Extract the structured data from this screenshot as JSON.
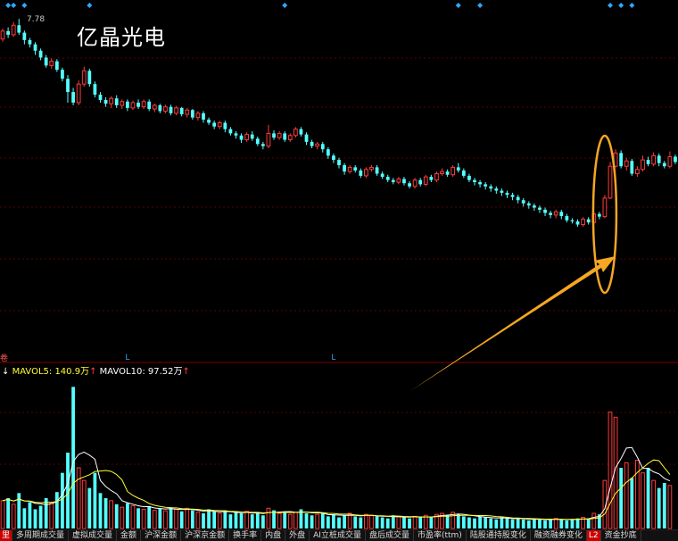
{
  "stock": {
    "name": "亿晶光电",
    "max_price_label": "7.78"
  },
  "volume_legend": {
    "arrow_prefix": "↓",
    "mavol5_label": "MAVOL5:",
    "mavol5_value": "140.9万",
    "mavol5_arrow": "↑",
    "mavol10_label": "MAVOL10:",
    "mavol10_value": "97.52万",
    "mavol10_arrow": "↑"
  },
  "corner_tag": "卷",
  "markers": {
    "l_label": "L"
  },
  "tabs": [
    {
      "label": "里",
      "style": "red"
    },
    {
      "label": "多周期成交量",
      "style": ""
    },
    {
      "label": "虚拟成交量",
      "style": ""
    },
    {
      "label": "金额",
      "style": ""
    },
    {
      "label": "沪深金额",
      "style": ""
    },
    {
      "label": "沪深京金额",
      "style": ""
    },
    {
      "label": "换手率",
      "style": ""
    },
    {
      "label": "内盘",
      "style": ""
    },
    {
      "label": "外盘",
      "style": ""
    },
    {
      "label": "AI立桩成交量",
      "style": ""
    },
    {
      "label": "盘后成交量",
      "style": ""
    },
    {
      "label": "市盈率(ttm)",
      "style": ""
    },
    {
      "label": "陆股通持股变化",
      "style": ""
    },
    {
      "label": "融资融券变化",
      "style": ""
    },
    {
      "label": "L2",
      "style": "red"
    },
    {
      "label": "资金抄底",
      "style": ""
    }
  ],
  "colors": {
    "up": "#ff3b3b",
    "down": "#54ffff",
    "ma5": "#ffffff",
    "ma10": "#ffff33",
    "highlight": "#f5a623",
    "grid": "#5a0000",
    "marker": "#2ea8ff"
  },
  "chart_data": {
    "type": "candlestick",
    "price_range": [
      3.0,
      7.9
    ],
    "candles": [
      [
        7.4,
        7.55,
        7.35,
        7.6
      ],
      [
        7.55,
        7.48,
        7.42,
        7.62
      ],
      [
        7.48,
        7.66,
        7.44,
        7.72
      ],
      [
        7.66,
        7.52,
        7.48,
        7.78
      ],
      [
        7.52,
        7.38,
        7.3,
        7.56
      ],
      [
        7.38,
        7.3,
        7.24,
        7.42
      ],
      [
        7.3,
        7.18,
        7.1,
        7.34
      ],
      [
        7.18,
        7.05,
        7.0,
        7.22
      ],
      [
        7.05,
        6.9,
        6.86,
        7.1
      ],
      [
        6.9,
        6.98,
        6.84,
        7.04
      ],
      [
        6.98,
        6.82,
        6.78,
        7.02
      ],
      [
        6.82,
        6.65,
        6.6,
        6.86
      ],
      [
        6.65,
        6.4,
        6.2,
        6.72
      ],
      [
        6.4,
        6.2,
        6.15,
        6.48
      ],
      [
        6.2,
        6.55,
        6.15,
        6.62
      ],
      [
        6.55,
        6.8,
        6.5,
        6.88
      ],
      [
        6.8,
        6.55,
        6.5,
        6.84
      ],
      [
        6.55,
        6.35,
        6.3,
        6.6
      ],
      [
        6.35,
        6.25,
        6.2,
        6.4
      ],
      [
        6.25,
        6.18,
        6.12,
        6.3
      ],
      [
        6.18,
        6.28,
        6.1,
        6.32
      ],
      [
        6.28,
        6.15,
        6.1,
        6.34
      ],
      [
        6.15,
        6.22,
        6.08,
        6.26
      ],
      [
        6.22,
        6.1,
        6.04,
        6.26
      ],
      [
        6.1,
        6.2,
        6.06,
        6.24
      ],
      [
        6.2,
        6.12,
        6.08,
        6.26
      ],
      [
        6.12,
        6.22,
        6.08,
        6.26
      ],
      [
        6.22,
        6.08,
        6.04,
        6.26
      ],
      [
        6.08,
        6.15,
        6.02,
        6.18
      ],
      [
        6.15,
        6.04,
        6.0,
        6.18
      ],
      [
        6.04,
        6.12,
        6.0,
        6.16
      ],
      [
        6.12,
        6.0,
        5.96,
        6.16
      ],
      [
        6.0,
        6.1,
        5.96,
        6.14
      ],
      [
        6.1,
        5.98,
        5.94,
        6.12
      ],
      [
        5.98,
        6.06,
        5.92,
        6.1
      ],
      [
        6.06,
        5.92,
        5.88,
        6.08
      ],
      [
        5.92,
        6.0,
        5.86,
        6.04
      ],
      [
        6.0,
        5.88,
        5.82,
        6.04
      ],
      [
        5.88,
        5.82,
        5.78,
        5.92
      ],
      [
        5.82,
        5.75,
        5.7,
        5.86
      ],
      [
        5.75,
        5.82,
        5.7,
        5.86
      ],
      [
        5.82,
        5.7,
        5.64,
        5.86
      ],
      [
        5.7,
        5.62,
        5.58,
        5.74
      ],
      [
        5.62,
        5.58,
        5.52,
        5.66
      ],
      [
        5.58,
        5.5,
        5.44,
        5.62
      ],
      [
        5.5,
        5.6,
        5.46,
        5.64
      ],
      [
        5.6,
        5.52,
        5.48,
        5.66
      ],
      [
        5.52,
        5.42,
        5.38,
        5.56
      ],
      [
        5.42,
        5.38,
        5.32,
        5.46
      ],
      [
        5.38,
        5.62,
        5.34,
        5.78
      ],
      [
        5.62,
        5.54,
        5.5,
        5.68
      ],
      [
        5.54,
        5.62,
        5.5,
        5.66
      ],
      [
        5.62,
        5.5,
        5.46,
        5.66
      ],
      [
        5.5,
        5.58,
        5.46,
        5.62
      ],
      [
        5.58,
        5.7,
        5.54,
        5.74
      ],
      [
        5.7,
        5.6,
        5.56,
        5.74
      ],
      [
        5.6,
        5.46,
        5.4,
        5.64
      ],
      [
        5.46,
        5.38,
        5.34,
        5.5
      ],
      [
        5.38,
        5.42,
        5.32,
        5.46
      ],
      [
        5.42,
        5.32,
        5.26,
        5.46
      ],
      [
        5.32,
        5.2,
        5.14,
        5.36
      ],
      [
        5.2,
        5.12,
        5.06,
        5.24
      ],
      [
        5.12,
        5.02,
        4.96,
        5.16
      ],
      [
        5.02,
        4.9,
        4.84,
        5.06
      ],
      [
        4.9,
        4.98,
        4.86,
        5.02
      ],
      [
        4.98,
        4.92,
        4.88,
        5.02
      ],
      [
        4.92,
        4.82,
        4.78,
        4.96
      ],
      [
        4.82,
        4.94,
        4.78,
        4.98
      ],
      [
        4.94,
        4.98,
        4.9,
        5.02
      ],
      [
        4.98,
        4.86,
        4.82,
        5.02
      ],
      [
        4.86,
        4.8,
        4.76,
        4.9
      ],
      [
        4.8,
        4.74,
        4.7,
        4.84
      ],
      [
        4.74,
        4.7,
        4.66,
        4.78
      ],
      [
        4.7,
        4.76,
        4.66,
        4.8
      ],
      [
        4.76,
        4.68,
        4.64,
        4.8
      ],
      [
        4.68,
        4.62,
        4.58,
        4.72
      ],
      [
        4.62,
        4.74,
        4.58,
        4.78
      ],
      [
        4.74,
        4.66,
        4.62,
        4.78
      ],
      [
        4.66,
        4.8,
        4.62,
        4.84
      ],
      [
        4.8,
        4.74,
        4.7,
        4.84
      ],
      [
        4.74,
        4.86,
        4.7,
        4.9
      ],
      [
        4.86,
        4.9,
        4.82,
        4.96
      ],
      [
        4.9,
        4.84,
        4.8,
        4.94
      ],
      [
        4.84,
        4.98,
        4.8,
        5.02
      ],
      [
        4.98,
        4.92,
        4.88,
        5.06
      ],
      [
        4.92,
        4.82,
        4.78,
        4.96
      ],
      [
        4.82,
        4.74,
        4.7,
        4.86
      ],
      [
        4.74,
        4.7,
        4.64,
        4.78
      ],
      [
        4.7,
        4.66,
        4.6,
        4.74
      ],
      [
        4.66,
        4.62,
        4.56,
        4.7
      ],
      [
        4.62,
        4.58,
        4.52,
        4.66
      ],
      [
        4.58,
        4.54,
        4.48,
        4.62
      ],
      [
        4.54,
        4.5,
        4.44,
        4.58
      ],
      [
        4.5,
        4.46,
        4.4,
        4.54
      ],
      [
        4.46,
        4.42,
        4.36,
        4.5
      ],
      [
        4.42,
        4.36,
        4.3,
        4.46
      ],
      [
        4.36,
        4.3,
        4.24,
        4.4
      ],
      [
        4.3,
        4.26,
        4.2,
        4.34
      ],
      [
        4.26,
        4.22,
        4.16,
        4.3
      ],
      [
        4.22,
        4.18,
        4.12,
        4.26
      ],
      [
        4.18,
        4.12,
        4.06,
        4.22
      ],
      [
        4.12,
        4.08,
        4.02,
        4.16
      ],
      [
        4.08,
        4.14,
        4.02,
        4.18
      ],
      [
        4.14,
        4.06,
        4.0,
        4.18
      ],
      [
        4.06,
        3.98,
        3.94,
        4.1
      ],
      [
        3.98,
        3.96,
        3.92,
        4.02
      ],
      [
        3.96,
        3.9,
        3.86,
        4.0
      ],
      [
        3.9,
        4.0,
        3.86,
        4.04
      ],
      [
        4.0,
        3.94,
        3.9,
        4.04
      ],
      [
        3.94,
        4.1,
        3.9,
        4.14
      ],
      [
        4.1,
        4.05,
        4.0,
        4.14
      ],
      [
        4.05,
        4.4,
        4.02,
        4.46
      ],
      [
        4.4,
        5.0,
        4.38,
        5.08
      ],
      [
        5.0,
        5.25,
        4.98,
        5.32
      ],
      [
        5.25,
        5.0,
        4.96,
        5.3
      ],
      [
        5.0,
        5.1,
        4.92,
        5.16
      ],
      [
        5.1,
        4.86,
        4.82,
        5.14
      ],
      [
        4.86,
        4.94,
        4.8,
        5.0
      ],
      [
        4.94,
        5.12,
        4.9,
        5.2
      ],
      [
        5.12,
        5.04,
        5.0,
        5.18
      ],
      [
        5.04,
        5.2,
        5.0,
        5.26
      ],
      [
        5.2,
        5.06,
        5.0,
        5.24
      ],
      [
        5.06,
        5.0,
        4.96,
        5.1
      ],
      [
        5.0,
        5.18,
        4.96,
        5.28
      ],
      [
        5.18,
        5.08,
        5.04,
        5.22
      ]
    ],
    "volume_range": [
      0,
      300
    ],
    "volumes": [
      55,
      60,
      48,
      70,
      40,
      52,
      38,
      45,
      60,
      50,
      72,
      110,
      150,
      280,
      120,
      95,
      80,
      110,
      70,
      60,
      55,
      48,
      42,
      50,
      45,
      40,
      38,
      44,
      36,
      40,
      35,
      42,
      38,
      34,
      40,
      36,
      32,
      30,
      38,
      34,
      30,
      36,
      28,
      32,
      30,
      34,
      28,
      30,
      26,
      40,
      36,
      30,
      34,
      28,
      32,
      38,
      30,
      26,
      28,
      30,
      24,
      28,
      22,
      26,
      30,
      24,
      22,
      28,
      26,
      24,
      22,
      20,
      26,
      24,
      22,
      20,
      24,
      22,
      26,
      22,
      28,
      30,
      26,
      32,
      28,
      24,
      22,
      20,
      24,
      22,
      20,
      18,
      22,
      20,
      18,
      20,
      18,
      16,
      20,
      18,
      16,
      18,
      20,
      18,
      16,
      18,
      20,
      22,
      20,
      30,
      28,
      95,
      230,
      220,
      120,
      130,
      100,
      135,
      110,
      120,
      95,
      80,
      90,
      85
    ],
    "ma5_line": "MAVOL5",
    "ma10_line": "MAVOL10",
    "highlight_candle_index": 111,
    "l_marker_indices": [
      23,
      61
    ],
    "top_marker_indices": [
      1,
      2,
      4,
      16,
      52,
      84,
      88,
      112,
      114,
      116,
      131
    ]
  }
}
